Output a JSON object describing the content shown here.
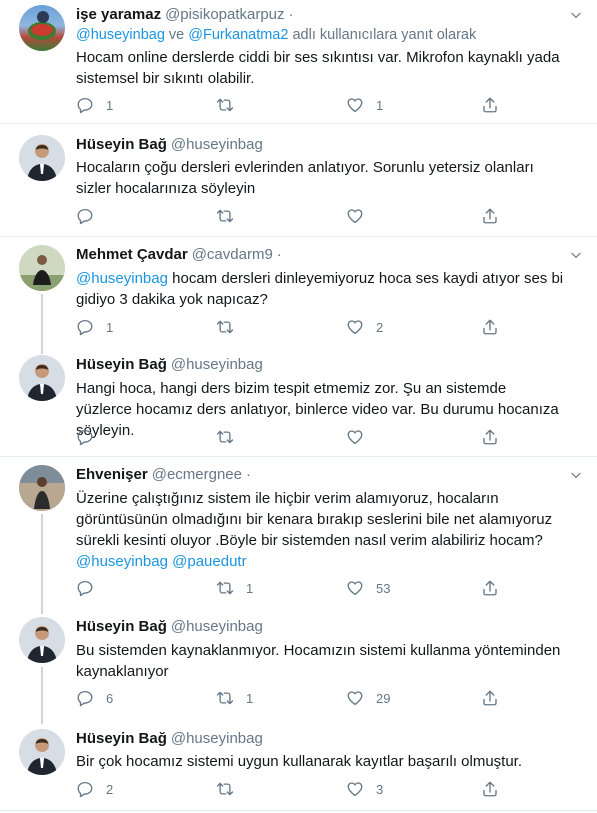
{
  "tweets": [
    {
      "name": "işe yaramaz",
      "handle": "@pisikopatkarpuz",
      "reply_to": {
        "user1": "@huseyinbag",
        "conj": "ve",
        "user2": "@Furkanatma2",
        "suffix": "adlı kullanıcılara yanıt olarak"
      },
      "text": "Hocam online derslerde ciddi bir ses sıkıntısı var. Mikrofon kaynaklı yada sistemsel bir sıkıntı olabilir.",
      "replies": "1",
      "retweets": "",
      "likes": "1"
    },
    {
      "name": "Hüseyin Bağ",
      "handle": "@huseyinbag",
      "text": "Hocaların çoğu dersleri evlerinden anlatıyor. Sorunlu yetersiz olanları sizler hocalarınıza söyleyin",
      "replies": "",
      "retweets": "",
      "likes": ""
    },
    {
      "name": "Mehmet Çavdar",
      "handle": "@cavdarm9",
      "mention": "@huseyinbag",
      "text": "hocam dersleri dinleyemiyoruz hoca ses kaydi atıyor ses bi gidiyo 3 dakika yok napıcaz?",
      "replies": "1",
      "retweets": "",
      "likes": "2"
    },
    {
      "name": "Hüseyin Bağ",
      "handle": "@huseyinbag",
      "text": "Hangi hoca, hangi ders bizim tespit etmemiz zor. Şu an sistemde yüzlerce hocamız ders anlatıyor, binlerce video var. Bu durumu hocanıza söyleyin.",
      "replies": "",
      "retweets": "",
      "likes": ""
    },
    {
      "name": "Ehvenişer",
      "handle": "@ecmergnee",
      "text": "Üzerine çalıştığınız sistem ile hiçbir verim alamıyoruz, hocaların görüntüsünün olmadığını bir kenara bırakıp seslerini bile net alamıyoruz sürekli kesinti oluyor .Böyle bir sistemden nasıl verim alabiliriz hocam?",
      "mentions_end": [
        "@huseyinbag",
        "@pauedutr"
      ],
      "replies": "",
      "retweets": "1",
      "likes": "53"
    },
    {
      "name": "Hüseyin Bağ",
      "handle": "@huseyinbag",
      "text": "Bu sistemden kaynaklanmıyor. Hocamızın sistemi kullanma yönteminden kaynaklanıyor",
      "replies": "6",
      "retweets": "1",
      "likes": "29"
    },
    {
      "name": "Hüseyin Bağ",
      "handle": "@huseyinbag",
      "text": "Bir çok hocamız sistemi uygun kullanarak kayıtlar başarılı olmuştur.",
      "replies": "2",
      "retweets": "",
      "likes": "3"
    }
  ],
  "separator": "·",
  "icons": {
    "reply": "reply-icon",
    "retweet": "retweet-icon",
    "like": "heart-icon",
    "share": "share-icon",
    "menu": "chevron-down-icon"
  },
  "colors": {
    "link": "#1b95e0",
    "muted": "#657786",
    "text": "#14171a",
    "divider": "#e6ecf0",
    "thread_line": "#ccd6dd"
  }
}
